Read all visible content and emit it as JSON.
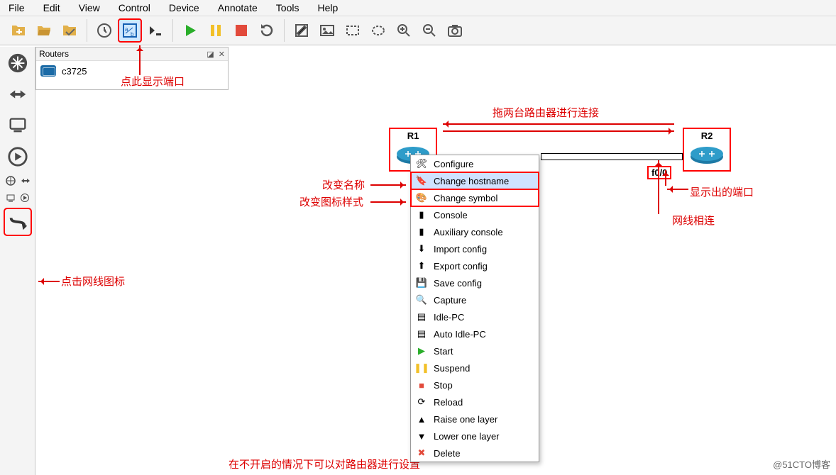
{
  "menu": {
    "file": "File",
    "edit": "Edit",
    "view": "View",
    "control": "Control",
    "device": "Device",
    "annotate": "Annotate",
    "tools": "Tools",
    "help": "Help"
  },
  "panel": {
    "title": "Routers",
    "item": "c3725"
  },
  "routers": {
    "r1": "R1",
    "r2": "R2",
    "port": "f0/0"
  },
  "ctx": {
    "configure": "Configure",
    "hostname": "Change hostname",
    "symbol": "Change symbol",
    "console": "Console",
    "auxconsole": "Auxiliary console",
    "importcfg": "Import config",
    "exportcfg": "Export config",
    "savecfg": "Save config",
    "capture": "Capture",
    "idlepc": "Idle-PC",
    "autoidle": "Auto Idle-PC",
    "start": "Start",
    "suspend": "Suspend",
    "stop": "Stop",
    "reload": "Reload",
    "raise": "Raise one layer",
    "lower": "Lower one layer",
    "delete": "Delete"
  },
  "anno": {
    "showport": "点此显示端口",
    "clickcable": "点击网线图标",
    "changename": "改变名称",
    "changesym": "改变图标样式",
    "dragconnect": "拖两台路由器进行连接",
    "shownport": "显示出的端口",
    "wired": "网线相连",
    "note": "在不开启的情况下可以对路由器进行设置"
  },
  "watermark": "@51CTO博客"
}
